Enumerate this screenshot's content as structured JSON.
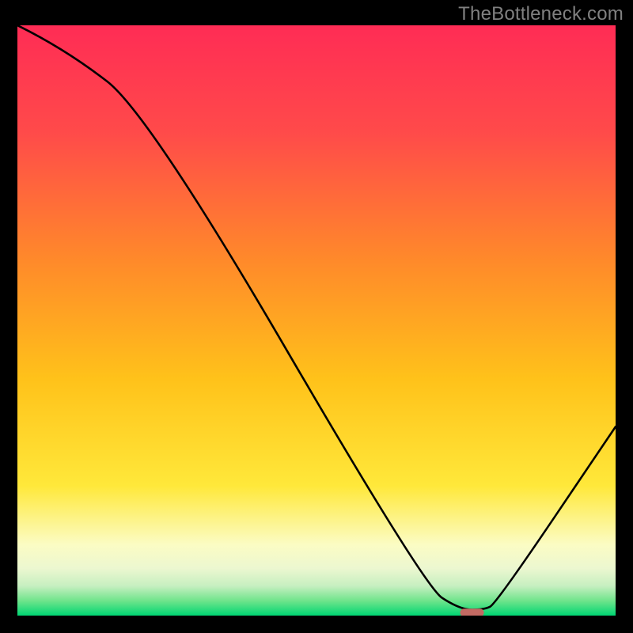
{
  "watermark": "TheBottleneck.com",
  "chart_data": {
    "type": "line",
    "title": "",
    "xlabel": "",
    "ylabel": "",
    "xlim": [
      0,
      100
    ],
    "ylim": [
      0,
      100
    ],
    "x": [
      0,
      8,
      22,
      68,
      74,
      78,
      80,
      100
    ],
    "values": [
      100,
      96,
      85,
      5,
      1,
      1,
      2,
      32
    ],
    "minimum_marker": {
      "x_start": 74,
      "x_end": 78,
      "y": 0.5,
      "color": "#c36a63"
    },
    "gradient_stops": [
      {
        "offset": 0.0,
        "color": "#ff2c55"
      },
      {
        "offset": 0.18,
        "color": "#ff4a4a"
      },
      {
        "offset": 0.4,
        "color": "#ff8a2a"
      },
      {
        "offset": 0.6,
        "color": "#ffc21a"
      },
      {
        "offset": 0.78,
        "color": "#ffe83a"
      },
      {
        "offset": 0.88,
        "color": "#fbfcc4"
      },
      {
        "offset": 0.92,
        "color": "#ecf7d0"
      },
      {
        "offset": 0.95,
        "color": "#c6efc0"
      },
      {
        "offset": 0.975,
        "color": "#6fe48b"
      },
      {
        "offset": 1.0,
        "color": "#00d673"
      }
    ]
  }
}
